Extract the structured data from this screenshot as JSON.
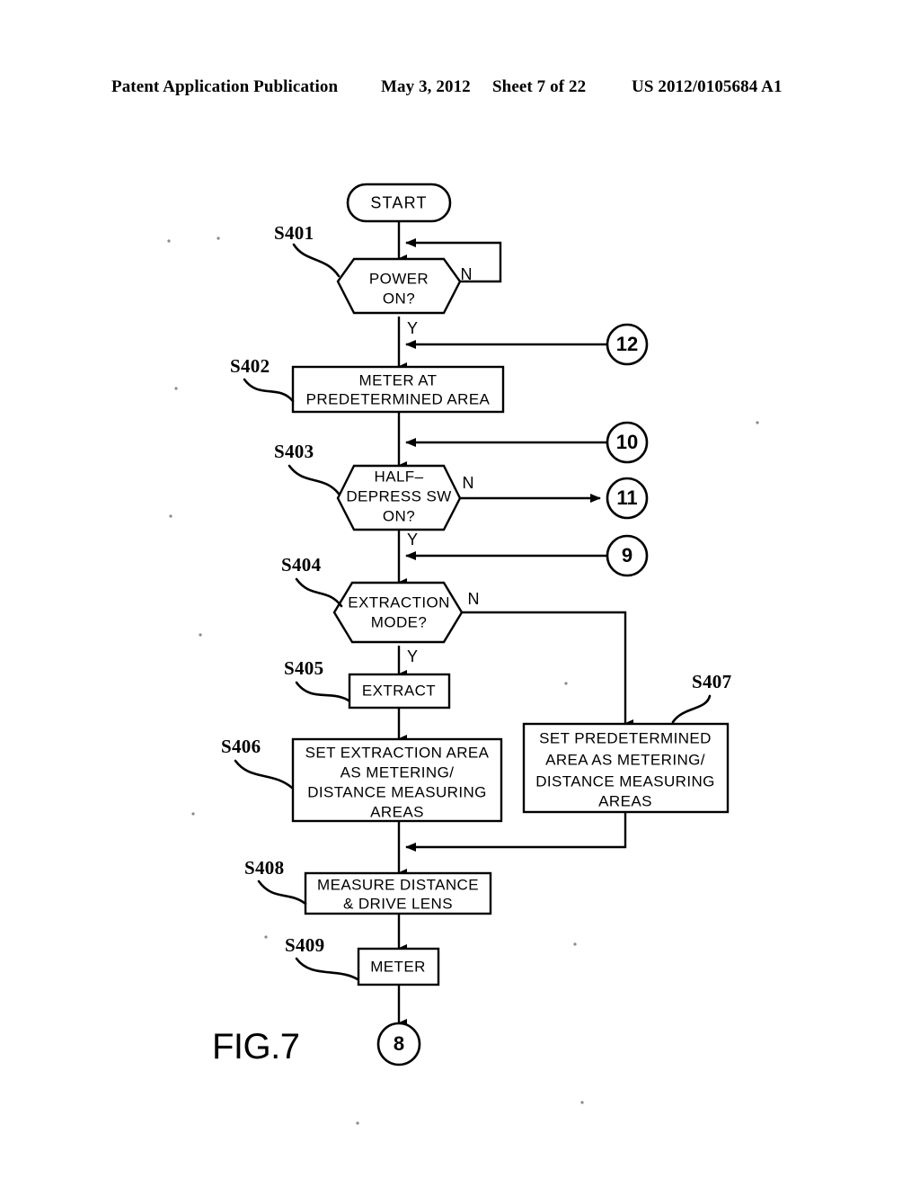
{
  "header": {
    "publication": "Patent Application Publication",
    "date": "May 3, 2012",
    "sheet": "Sheet 7 of 22",
    "patent_number": "US 2012/0105684 A1"
  },
  "figure": {
    "caption": "FIG.7"
  },
  "chart_data": {
    "type": "diagram",
    "title": "FIG.7",
    "diagram_kind": "flowchart",
    "orientation": "top-to-bottom"
  },
  "nodes": {
    "start": {
      "id": "start",
      "shape": "terminal",
      "label": "START"
    },
    "s401": {
      "id": "S401",
      "shape": "decision",
      "step": "S401",
      "line1": "POWER",
      "line2": "ON?"
    },
    "s402": {
      "id": "S402",
      "shape": "process",
      "step": "S402",
      "line1": "METER AT",
      "line2": "PREDETERMINED AREA"
    },
    "s403": {
      "id": "S403",
      "shape": "decision",
      "step": "S403",
      "line1": "HALF–",
      "line2": "DEPRESS SW",
      "line3": "ON?"
    },
    "s404": {
      "id": "S404",
      "shape": "decision",
      "step": "S404",
      "line1": "EXTRACTION",
      "line2": "MODE?"
    },
    "s405": {
      "id": "S405",
      "shape": "process",
      "step": "S405",
      "line1": "EXTRACT"
    },
    "s406": {
      "id": "S406",
      "shape": "process",
      "step": "S406",
      "line1": "SET EXTRACTION AREA",
      "line2": "AS METERING/",
      "line3": "DISTANCE MEASURING",
      "line4": "AREAS"
    },
    "s407": {
      "id": "S407",
      "shape": "process",
      "step": "S407",
      "line1": "SET PREDETERMINED",
      "line2": "AREA AS METERING/",
      "line3": "DISTANCE MEASURING",
      "line4": "AREAS"
    },
    "s408": {
      "id": "S408",
      "shape": "process",
      "step": "S408",
      "line1": "MEASURE DISTANCE",
      "line2": "& DRIVE LENS"
    },
    "s409": {
      "id": "S409",
      "shape": "process",
      "step": "S409",
      "line1": "METER"
    }
  },
  "connectors": {
    "c12": {
      "label": "12"
    },
    "c10": {
      "label": "10"
    },
    "c11": {
      "label": "11"
    },
    "c9": {
      "label": "9"
    },
    "c8": {
      "label": "8"
    }
  },
  "branches": {
    "s401_n": "N",
    "s401_y": "Y",
    "s403_n": "N",
    "s403_y": "Y",
    "s404_n": "N",
    "s404_y": "Y"
  },
  "colors": {
    "ink": "#000000",
    "paper": "#ffffff"
  }
}
